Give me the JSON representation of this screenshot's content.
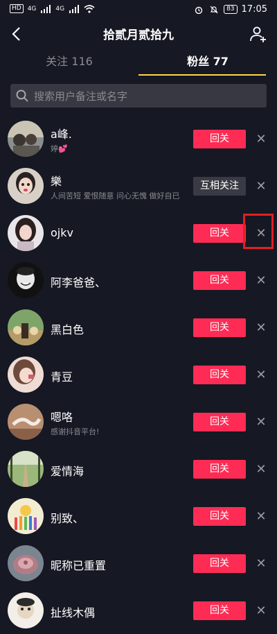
{
  "status_bar": {
    "left_chip": "HD",
    "signal_1": "4G",
    "signal_2": "4G",
    "battery": "83",
    "time": "17:05"
  },
  "header": {
    "title": "拾贰月贰拾九",
    "back_icon": "back-chevron-icon",
    "add_friend_icon": "add-user-icon"
  },
  "tabs": [
    {
      "label": "关注 116"
    },
    {
      "label": "粉丝 77"
    }
  ],
  "search": {
    "placeholder": "搜索用户备注或名字"
  },
  "colors": {
    "background": "#161823",
    "accent_red": "#fe2c55",
    "tab_underline": "#fcd94b",
    "mutual_button": "#393b44",
    "highlight": "#e21f24"
  },
  "fans": [
    {
      "name": "a峰.",
      "bio": "婷💕",
      "button": "回关",
      "state": "follow-back"
    },
    {
      "name": "樂",
      "bio": "人间苦短 爱恨随意 问心无愧 做好自已",
      "button": "互相关注",
      "state": "mutual"
    },
    {
      "name": "ojkv",
      "bio": "",
      "button": "回关",
      "state": "follow-back"
    },
    {
      "name": "阿李爸爸、",
      "bio": "",
      "button": "回关",
      "state": "follow-back"
    },
    {
      "name": "黑白色",
      "bio": "",
      "button": "回关",
      "state": "follow-back"
    },
    {
      "name": "青豆",
      "bio": "",
      "button": "回关",
      "state": "follow-back"
    },
    {
      "name": "嗯咯",
      "bio": "感谢抖音平台!",
      "button": "回关",
      "state": "follow-back"
    },
    {
      "name": "爱情海",
      "bio": "",
      "button": "回关",
      "state": "follow-back"
    },
    {
      "name": "别致、",
      "bio": "",
      "button": "回关",
      "state": "follow-back"
    },
    {
      "name": "昵称已重置",
      "bio": "",
      "button": "回关",
      "state": "follow-back"
    },
    {
      "name": "扯线木偶",
      "bio": "",
      "button": "回关",
      "state": "follow-back"
    }
  ],
  "remove_glyph": "✕"
}
